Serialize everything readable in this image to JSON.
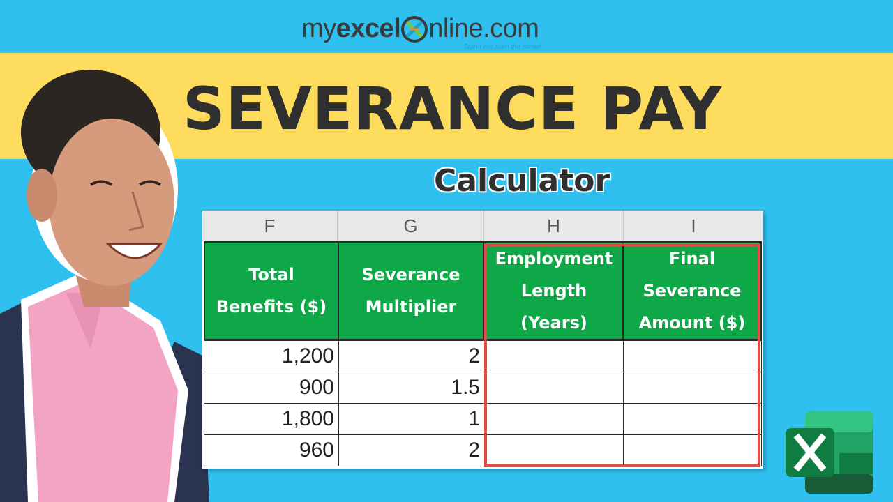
{
  "logo": {
    "prefix": "my",
    "bold": "excel",
    "suffix": "nline.com",
    "tagline": "Stand out from the crowd"
  },
  "title": "SEVERANCE PAY",
  "subtitle": "Calculator",
  "sheet": {
    "columns": [
      "F",
      "G",
      "H",
      "I"
    ],
    "headers": [
      "Total\nBenefits ($)",
      "Severance\nMultiplier",
      "Employment\nLength\n(Years)",
      "Final\nSeverance\nAmount ($)"
    ],
    "rows": [
      [
        "1,200",
        "2",
        "",
        ""
      ],
      [
        "900",
        "1.5",
        "",
        ""
      ],
      [
        "1,800",
        "1",
        "",
        ""
      ],
      [
        "960",
        "2",
        "",
        ""
      ]
    ],
    "colors": {
      "header_green": "#0fa849",
      "highlight_red": "#e24a42"
    }
  },
  "icons": {
    "app": "excel-icon"
  }
}
